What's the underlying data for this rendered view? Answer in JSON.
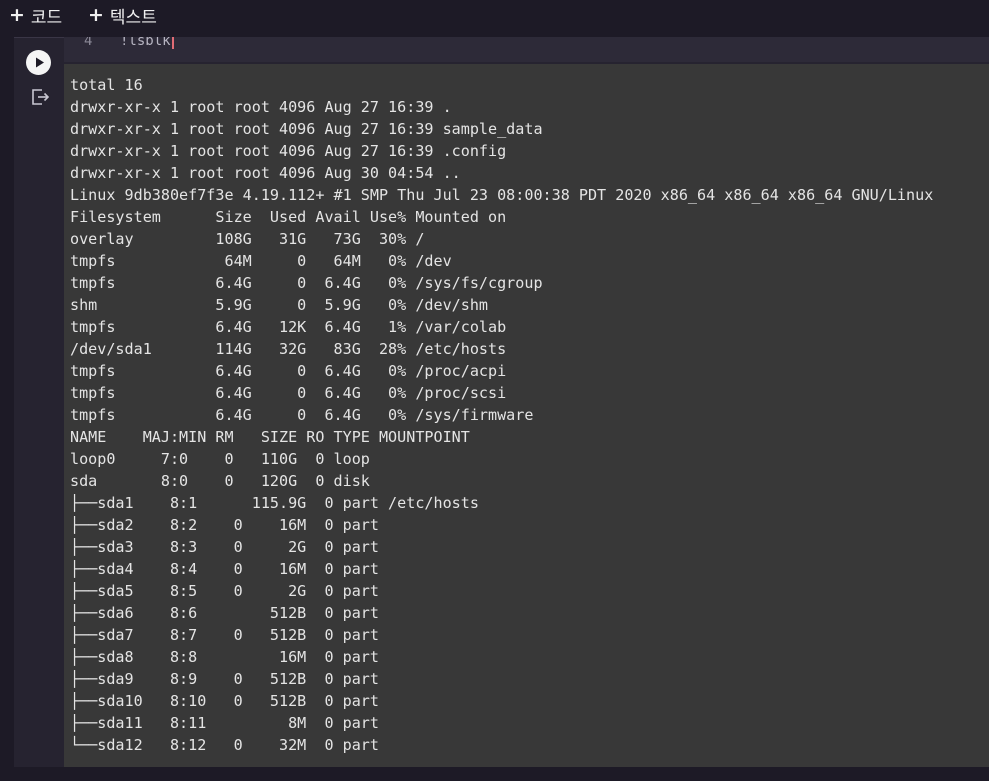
{
  "toolbar": {
    "code_label": "코드",
    "text_label": "텍스트",
    "plus_glyph": "+"
  },
  "editor": {
    "line_number": "4",
    "code": "!lsblk"
  },
  "icons": {
    "run": "play-icon",
    "clear_output": "clear-output-icon"
  },
  "output": {
    "lines": [
      "total 16",
      "drwxr-xr-x 1 root root 4096 Aug 27 16:39 .",
      "drwxr-xr-x 1 root root 4096 Aug 27 16:39 sample_data",
      "drwxr-xr-x 1 root root 4096 Aug 27 16:39 .config",
      "drwxr-xr-x 1 root root 4096 Aug 30 04:54 ..",
      "Linux 9db380ef7f3e 4.19.112+ #1 SMP Thu Jul 23 08:00:38 PDT 2020 x86_64 x86_64 x86_64 GNU/Linux",
      "Filesystem      Size  Used Avail Use% Mounted on",
      "overlay         108G   31G   73G  30% /",
      "tmpfs            64M     0   64M   0% /dev",
      "tmpfs           6.4G     0  6.4G   0% /sys/fs/cgroup",
      "shm             5.9G     0  5.9G   0% /dev/shm",
      "tmpfs           6.4G   12K  6.4G   1% /var/colab",
      "/dev/sda1       114G   32G   83G  28% /etc/hosts",
      "tmpfs           6.4G     0  6.4G   0% /proc/acpi",
      "tmpfs           6.4G     0  6.4G   0% /proc/scsi",
      "tmpfs           6.4G     0  6.4G   0% /sys/firmware",
      "NAME    MAJ:MIN RM   SIZE RO TYPE MOUNTPOINT",
      "loop0     7:0    0   110G  0 loop",
      "sda       8:0    0   120G  0 disk",
      "├──sda1    8:1      115.9G  0 part /etc/hosts",
      "├──sda2    8:2    0    16M  0 part",
      "├──sda3    8:3    0     2G  0 part",
      "├──sda4    8:4    0    16M  0 part",
      "├──sda5    8:5    0     2G  0 part",
      "├──sda6    8:6        512B  0 part",
      "├──sda7    8:7    0   512B  0 part",
      "├──sda8    8:8         16M  0 part",
      "├──sda9    8:9    0   512B  0 part",
      "├──sda10   8:10   0   512B  0 part",
      "├──sda11   8:11         8M  0 part",
      "└──sda12   8:12   0    32M  0 part"
    ]
  }
}
